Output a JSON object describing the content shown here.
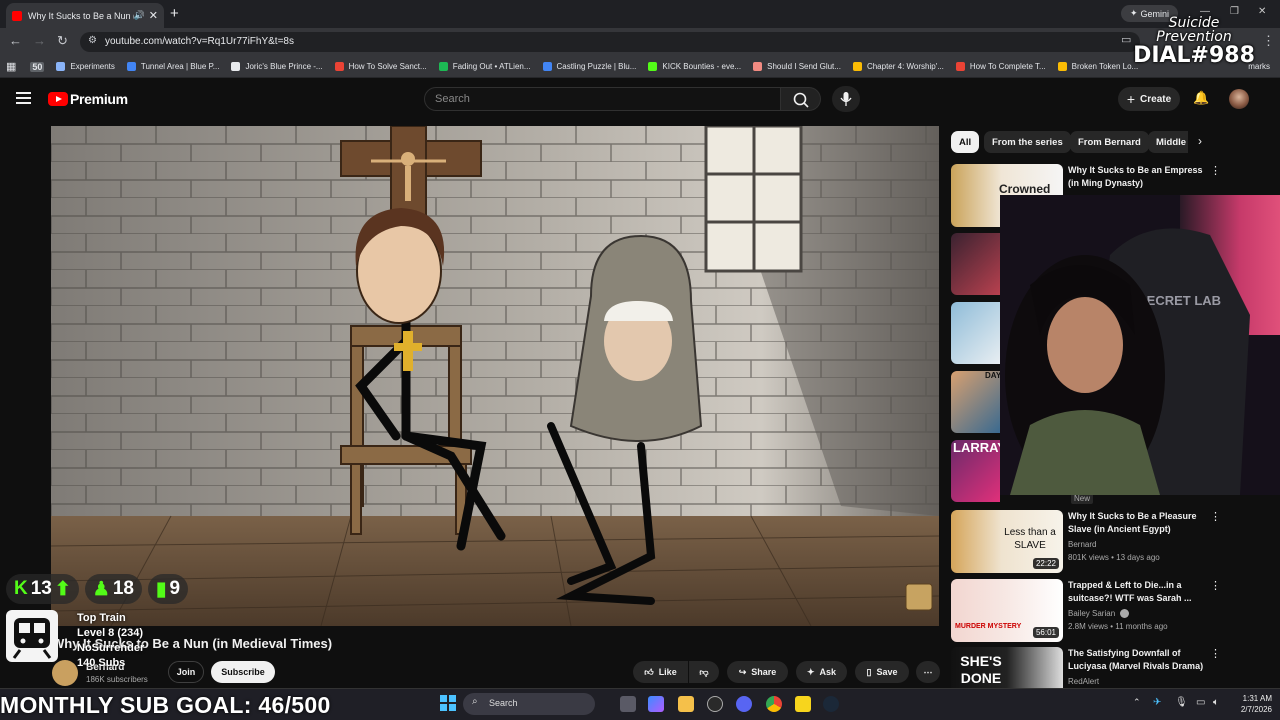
{
  "browser": {
    "tab_title": "Why It Sucks to Be a Nun (i...",
    "gemini_label": "Gemini",
    "url": "youtube.com/watch?v=Rq1Ur77iFhY&t=8s",
    "bookmarks": [
      {
        "label": "Experiments",
        "color": "#8ab4f8"
      },
      {
        "label": "Tunnel Area | Blue P...",
        "color": "#4285f4"
      },
      {
        "label": "Joric's Blue Prince -...",
        "color": "#e8eaed"
      },
      {
        "label": "How To Solve Sanct...",
        "color": "#ea4335"
      },
      {
        "label": "Fading Out • ATLien...",
        "color": "#1db954"
      },
      {
        "label": "Castling Puzzle | Blu...",
        "color": "#4285f4"
      },
      {
        "label": "KICK Bounties - eve...",
        "color": "#53fc18"
      },
      {
        "label": "Should I Send Glut...",
        "color": "#f28b82"
      },
      {
        "label": "Chapter 4: Worship'...",
        "color": "#fbbc04"
      },
      {
        "label": "How To Complete T...",
        "color": "#ea4335"
      },
      {
        "label": "Broken Token Lo...",
        "color": "#fbbc04"
      }
    ],
    "bookmarks_tail": "marks"
  },
  "youtube": {
    "logo_text": "Premium",
    "search_placeholder": "Search",
    "create_label": "Create",
    "chips": [
      "All",
      "From the series",
      "From Bernard",
      "Middle"
    ],
    "video_title": "Why It Sucks to Be a Nun (in Medieval Times)",
    "channel": "Bernard",
    "subscribers": "186K subscribers",
    "join_label": "Join",
    "subscribe_label": "Subscribe",
    "actions": {
      "like": "Like",
      "share": "Share",
      "ask": "Ask",
      "save": "Save"
    },
    "recommendations": [
      {
        "title": "Why It Sucks to Be an Empress (in Ming Dynasty)",
        "channel": "",
        "meta": "",
        "duration": "",
        "thumb_text": "Crowned"
      },
      {
        "title": "Why It Sucks to Be a Pleasure Slave (in Ancient Egypt)",
        "channel": "Bernard",
        "meta": "801K views • 13 days ago",
        "duration": "22:22",
        "thumb_text": "Less than a SLAVE"
      },
      {
        "title": "Trapped & Left to Die...in a suitcase?! WTF was Sarah ...",
        "channel": "Bailey Sarian",
        "meta": "2.8M views • 11 months ago",
        "duration": "56:01",
        "thumb_text": "MURDER MYSTERY"
      },
      {
        "title": "The Satisfying Downfall of Luciyasa (Marvel Rivals Drama)",
        "channel": "RedAlert",
        "meta": "",
        "duration": "",
        "thumb_text": "SHE'S DONE"
      }
    ],
    "partial_thumbs": [
      "DAY",
      "LARRAY"
    ],
    "new_badge": "New"
  },
  "overlay": {
    "stats": [
      {
        "icon": "K",
        "value": "13"
      },
      {
        "icon": "♟",
        "value": "18"
      },
      {
        "icon": "▮",
        "value": "9"
      }
    ],
    "train_title": "Top Train",
    "train_level": "Level 8  (234)",
    "train_user": "NoSurrender",
    "train_subs": "140 Subs",
    "sub_goal": "MONTHLY SUB GOAL: 46/500",
    "suicide_lines": [
      "Suicide",
      "Prevention"
    ],
    "dial": "DIAL#988",
    "secret_lab": "SECRET LAB"
  },
  "taskbar": {
    "search_label": "Search",
    "time": "1:31 AM",
    "date": "2/7/2026"
  }
}
